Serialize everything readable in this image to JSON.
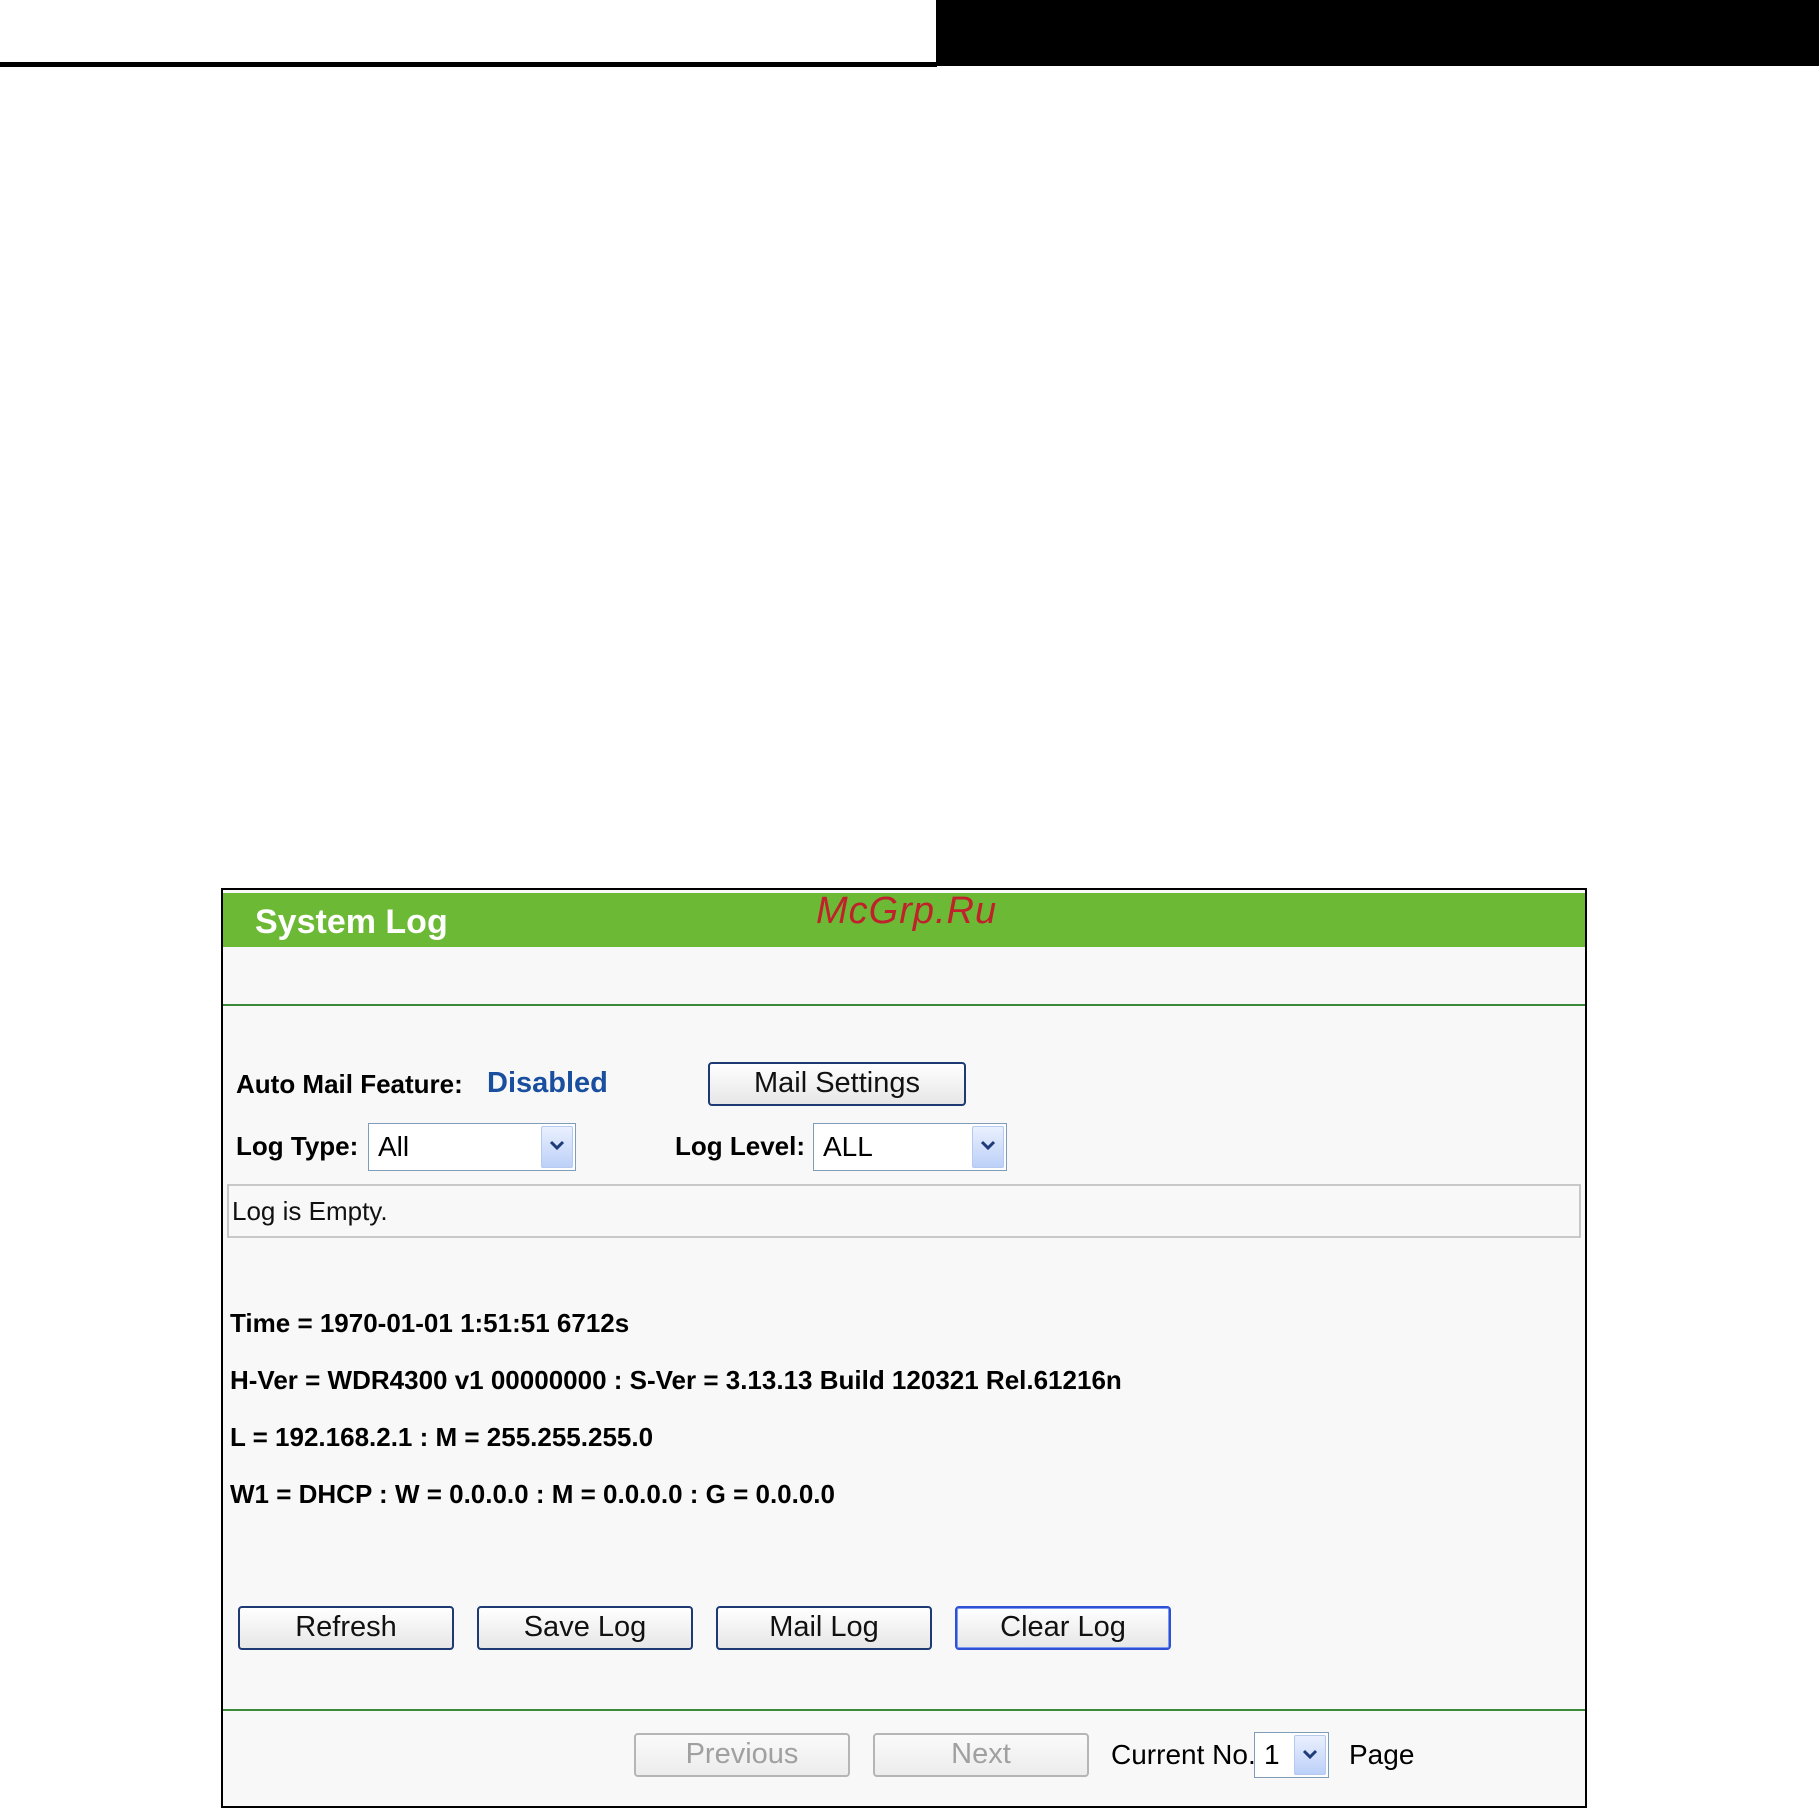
{
  "panel": {
    "title": "System Log",
    "watermark": "McGrp.Ru"
  },
  "auto_mail": {
    "label": "Auto Mail Feature:",
    "status": "Disabled",
    "settings_button": "Mail Settings"
  },
  "filters": {
    "log_type_label": "Log Type:",
    "log_type_value": "All",
    "log_level_label": "Log Level:",
    "log_level_value": "ALL"
  },
  "log": {
    "message": "Log is Empty."
  },
  "info_lines": [
    "Time = 1970-01-01 1:51:51 6712s",
    "H-Ver = WDR4300 v1 00000000 : S-Ver = 3.13.13 Build 120321 Rel.61216n",
    "L = 192.168.2.1 : M = 255.255.255.0",
    "W1 = DHCP : W = 0.0.0.0 : M = 0.0.0.0 : G = 0.0.0.0"
  ],
  "actions": {
    "refresh": "Refresh",
    "save_log": "Save Log",
    "mail_log": "Mail Log",
    "clear_log": "Clear Log"
  },
  "pagination": {
    "previous": "Previous",
    "next": "Next",
    "current_label": "Current No.",
    "current_value": "1",
    "page_label": "Page"
  },
  "colors": {
    "title_bar": "#6cb936",
    "disabled_status": "#1a4fa0",
    "watermark": "#c0212b"
  }
}
